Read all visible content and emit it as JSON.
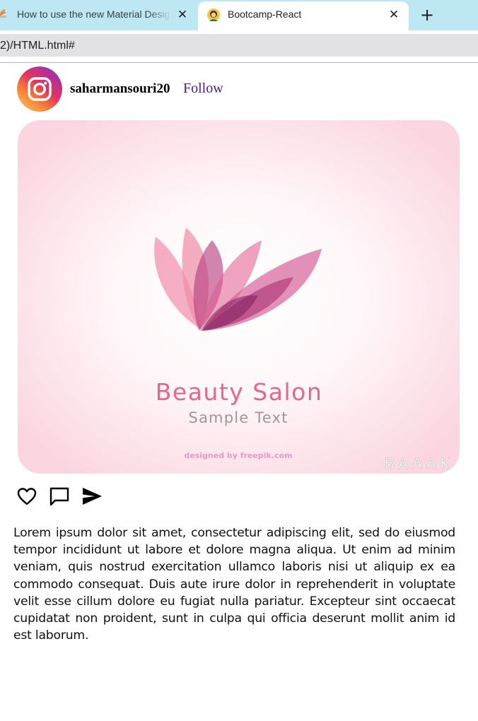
{
  "browser": {
    "tabs": [
      {
        "title": "How to use the new Material Design",
        "active": false
      },
      {
        "title": "Bootcamp-React",
        "active": true
      }
    ],
    "close_label": "✕",
    "new_tab_label": "+",
    "url": "2)/HTML.html#"
  },
  "post": {
    "username": "saharmansouri20",
    "follow_label": "Follow",
    "image": {
      "headline": "Beauty Salon",
      "subheadline": "Sample Text",
      "credit": "designed by freepik.com",
      "watermark": "BAAAK"
    },
    "actions": [
      {
        "icon": "heart-icon"
      },
      {
        "icon": "comment-icon"
      },
      {
        "icon": "send-icon"
      }
    ],
    "caption": "Lorem ipsum dolor sit amet, consectetur adipiscing elit, sed do eiusmod tempor incididunt ut labore et dolore magna aliqua. Ut enim ad minim veniam, quis nostrud exercitation ullamco laboris nisi ut aliquip ex ea commodo consequat. Duis aute irure dolor in reprehenderit in voluptate velit esse cillum dolore eu fugiat nulla pariatur. Excepteur sint occaecat cupidatat non proident, sunt in culpa qui officia deserunt mollit anim id est laborum."
  },
  "colors": {
    "tabstrip": "#bde7f2",
    "follow": "#4b1c8e",
    "brand_pink": "#e05a8a"
  }
}
